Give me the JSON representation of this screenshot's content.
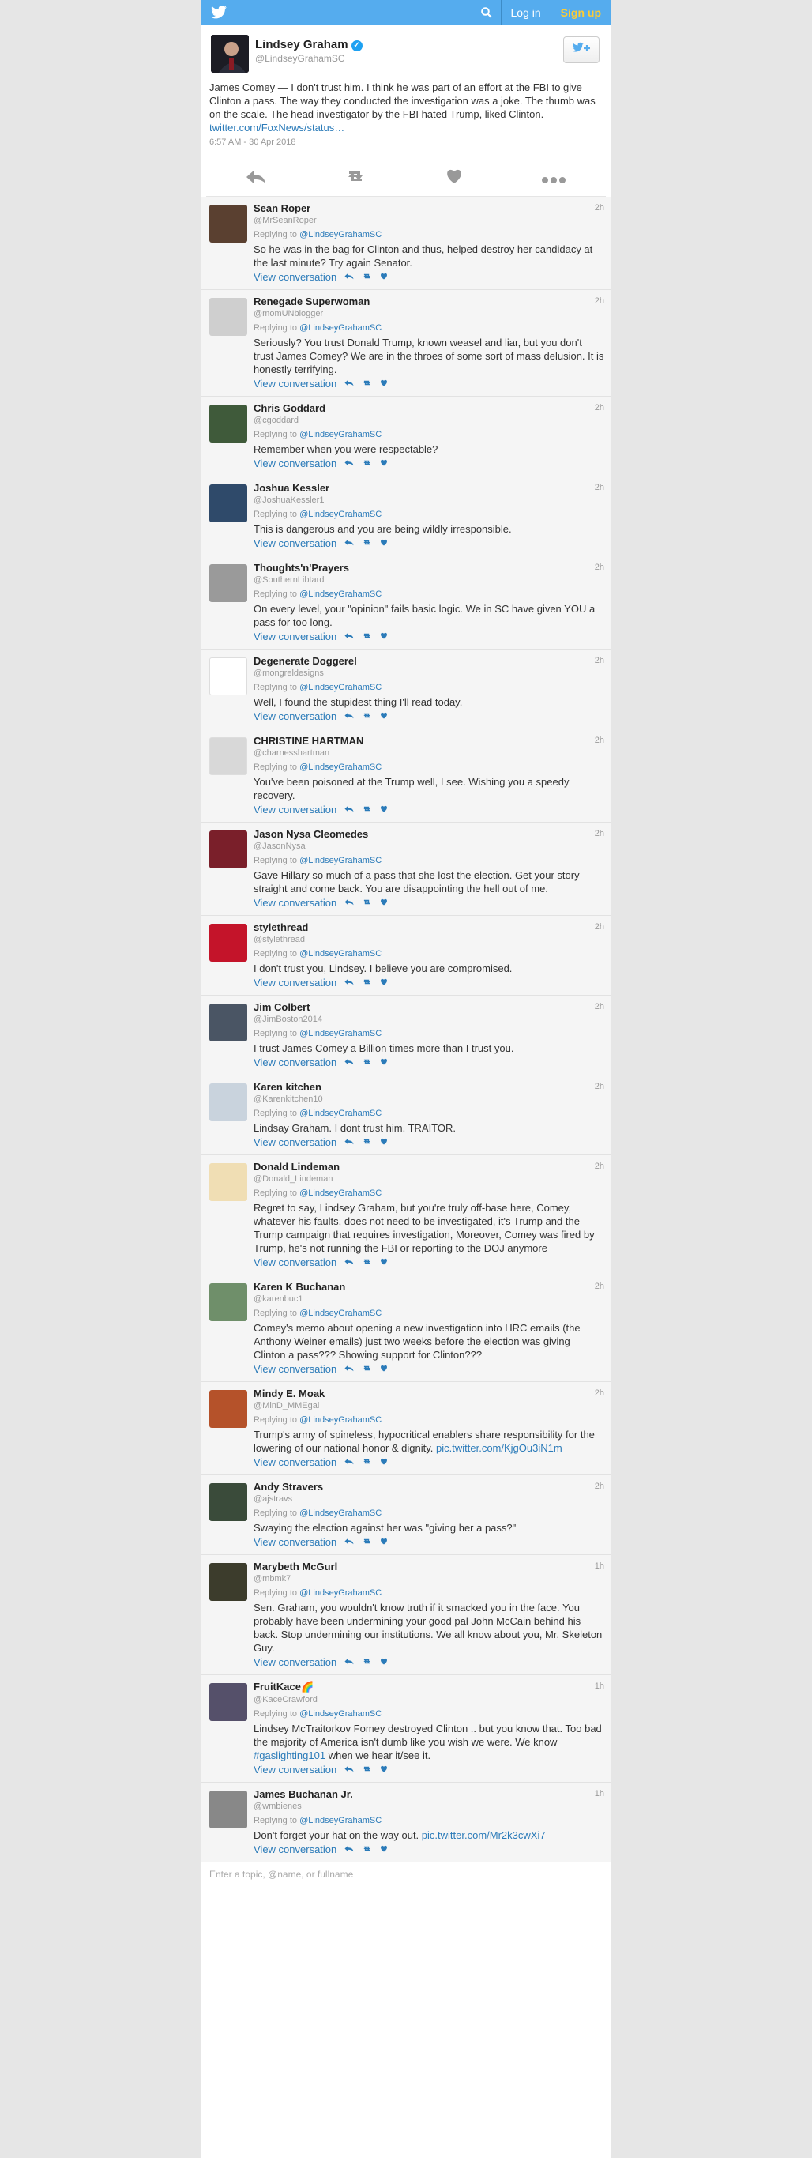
{
  "nav": {
    "bird_icon": "twitter-bird-icon",
    "search_icon": "search-icon",
    "login_label": "Log in",
    "signup_label": "Sign up",
    "colors": {
      "bar": "#55acee",
      "signup": "#ffcc33"
    }
  },
  "tweet": {
    "name": "Lindsey Graham",
    "handle": "@LindseyGrahamSC",
    "text": "James Comey — I don't trust him. I think he was part of an effort at the FBI to give Clinton a pass. The way they conducted the investigation was a joke. The thumb was on the scale. The head investigator by the FBI hated Trump, liked Clinton.",
    "link": "twitter.com/FoxNews/status…",
    "timestamp": "6:57 AM - 30 Apr 2018",
    "follow_icon": "follow-bird-plus-icon",
    "actions": [
      "reply-icon",
      "retweet-icon",
      "like-icon",
      "more-icon"
    ]
  },
  "replies": [
    {
      "name": "Sean Roper",
      "handle": "@MrSeanRoper",
      "time": "2h",
      "replying_prefix": "Replying to",
      "replying_to": "@LindseyGrahamSC",
      "text": "So he was in the bag for Clinton and thus, helped destroy her candidacy at the last minute? Try again Senator.",
      "view": "View conversation",
      "avatar_color": "#5a4030"
    },
    {
      "name": "Renegade Superwoman",
      "handle": "@momUNblogger",
      "time": "2h",
      "replying_prefix": "Replying to",
      "replying_to": "@LindseyGrahamSC",
      "text": "Seriously? You trust Donald Trump, known weasel and liar, but you don't trust James Comey? We are in the throes of some sort of mass delusion. It is honestly terrifying.",
      "view": "View conversation",
      "avatar_color": "#cfcfcf"
    },
    {
      "name": "Chris Goddard",
      "handle": "@cgoddard",
      "time": "2h",
      "replying_prefix": "Replying to",
      "replying_to": "@LindseyGrahamSC",
      "text": "Remember when you were respectable?",
      "view": "View conversation",
      "avatar_color": "#3f5a3a"
    },
    {
      "name": "Joshua Kessler",
      "handle": "@JoshuaKessler1",
      "time": "2h",
      "replying_prefix": "Replying to",
      "replying_to": "@LindseyGrahamSC",
      "text": "This is dangerous and you are being wildly irresponsible.",
      "view": "View conversation",
      "avatar_color": "#2f4a6a"
    },
    {
      "name": "Thoughts'n'Prayers",
      "handle": "@SouthernLibtard",
      "time": "2h",
      "replying_prefix": "Replying to",
      "replying_to": "@LindseyGrahamSC",
      "text": "On every level, your \"opinion\" fails basic logic. We in SC have given YOU a pass for too long.",
      "view": "View conversation",
      "avatar_color": "#9a9a9a"
    },
    {
      "name": "Degenerate Doggerel",
      "handle": "@mongreldesigns",
      "time": "2h",
      "replying_prefix": "Replying to",
      "replying_to": "@LindseyGrahamSC",
      "text": "Well, I found the stupidest thing I'll read today.",
      "view": "View conversation",
      "avatar_color": "#ffffff"
    },
    {
      "name": "CHRISTINE HARTMAN",
      "handle": "@charnesshartman",
      "time": "2h",
      "replying_prefix": "Replying to",
      "replying_to": "@LindseyGrahamSC",
      "text": "You've been poisoned at the Trump well, I see. Wishing you a speedy recovery.",
      "view": "View conversation",
      "avatar_color": "#d8d8d8"
    },
    {
      "name": "Jason Nysa Cleomedes",
      "handle": "@JasonNysa",
      "time": "2h",
      "replying_prefix": "Replying to",
      "replying_to": "@LindseyGrahamSC",
      "text": "Gave Hillary so much of a pass that she lost the election. Get your story straight and come back. You are disappointing the hell out of me.",
      "view": "View conversation",
      "avatar_color": "#7a1f2a"
    },
    {
      "name": "stylethread",
      "handle": "@stylethread",
      "time": "2h",
      "replying_prefix": "Replying to",
      "replying_to": "@LindseyGrahamSC",
      "text": "I don't trust you, Lindsey. I believe you are compromised.",
      "view": "View conversation",
      "avatar_color": "#c4142a"
    },
    {
      "name": "Jim Colbert",
      "handle": "@JimBoston2014",
      "time": "2h",
      "replying_prefix": "Replying to",
      "replying_to": "@LindseyGrahamSC",
      "text": "I trust James Comey a Billion times more than I trust you.",
      "view": "View conversation",
      "avatar_color": "#4a5564"
    },
    {
      "name": "Karen kitchen",
      "handle": "@Karenkitchen10",
      "time": "2h",
      "replying_prefix": "Replying to",
      "replying_to": "@LindseyGrahamSC",
      "text": "Lindsay Graham. I dont trust him. TRAITOR.",
      "view": "View conversation",
      "avatar_color": "#c9d3dd"
    },
    {
      "name": "Donald Lindeman",
      "handle": "@Donald_Lindeman",
      "time": "2h",
      "replying_prefix": "Replying to",
      "replying_to": "@LindseyGrahamSC",
      "text": "Regret to say, Lindsey Graham, but you're truly off-base here, Comey, whatever his faults, does not need to be investigated, it's Trump and the Trump campaign that requires investigation, Moreover, Comey was fired by Trump, he's not running the FBI or reporting to the DOJ anymore",
      "view": "View conversation",
      "avatar_color": "#f0deb4"
    },
    {
      "name": "Karen K Buchanan",
      "handle": "@karenbuc1",
      "time": "2h",
      "replying_prefix": "Replying to",
      "replying_to": "@LindseyGrahamSC",
      "text": "Comey's memo about opening a new investigation into HRC emails (the Anthony Weiner emails) just two weeks before the election was giving Clinton a pass??? Showing support for Clinton???",
      "view": "View conversation",
      "avatar_color": "#6f8f6a"
    },
    {
      "name": "Mindy E. Moak",
      "handle": "@MinD_MMEgal",
      "time": "2h",
      "replying_prefix": "Replying to",
      "replying_to": "@LindseyGrahamSC",
      "text": "Trump's army of spineless, hypocritical enablers share responsibility for the lowering of our national honor & dignity.",
      "link": "pic.twitter.com/KjgOu3iN1m",
      "view": "View conversation",
      "avatar_color": "#b5522a"
    },
    {
      "name": "Andy Stravers",
      "handle": "@ajstravs",
      "time": "2h",
      "replying_prefix": "Replying to",
      "replying_to": "@LindseyGrahamSC",
      "text": "Swaying the election against her was \"giving her a pass?\"",
      "view": "View conversation",
      "avatar_color": "#3a4b3a"
    },
    {
      "name": "Marybeth McGurl",
      "handle": "@mbmk7",
      "time": "1h",
      "replying_prefix": "Replying to",
      "replying_to": "@LindseyGrahamSC",
      "text": "Sen. Graham, you wouldn't know truth if it smacked you in the face. You probably have been undermining your good pal John McCain behind his back. Stop undermining our institutions. We all know about you, Mr. Skeleton Guy.",
      "view": "View conversation",
      "avatar_color": "#3c3c2c"
    },
    {
      "name": "FruitKace🌈",
      "handle": "@KaceCrawford",
      "time": "1h",
      "replying_prefix": "Replying to",
      "replying_to": "@LindseyGrahamSC",
      "text": "Lindsey McTraitorkov Fomey destroyed Clinton .. but you know that. Too bad the majority of America isn't dumb like you wish we were. We know",
      "hashtag": "#gaslighting101",
      "text_after": "when we hear it/see it.",
      "view": "View conversation",
      "avatar_color": "#55506a"
    },
    {
      "name": "James Buchanan Jr.",
      "handle": "@wmbienes",
      "time": "1h",
      "replying_prefix": "Replying to",
      "replying_to": "@LindseyGrahamSC",
      "text": "Don't forget your hat on the way out.",
      "link": "pic.twitter.com/Mr2k3cwXi7",
      "view": "View conversation",
      "avatar_color": "#888888"
    }
  ],
  "footer": {
    "placeholder": "Enter a topic, @name, or fullname"
  }
}
